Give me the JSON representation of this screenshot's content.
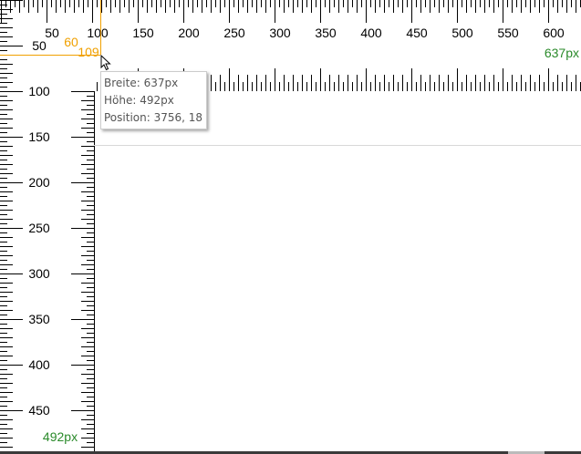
{
  "ruler": {
    "horizontal_labels": [
      "50",
      "100",
      "150",
      "200",
      "250",
      "300",
      "350",
      "400",
      "450",
      "500",
      "550",
      "600"
    ],
    "vertical_labels": [
      "50",
      "100",
      "150",
      "200",
      "250",
      "300",
      "350",
      "400",
      "450"
    ],
    "width_label": "637px",
    "height_label": "492px",
    "cursor_y_label": "60",
    "cursor_x_label": "109"
  },
  "tooltip": {
    "width": "Breite: 637px",
    "height": "Höhe: 492px",
    "position": "Position: 3756, 18"
  },
  "colors": {
    "crosshair": "#f0a000",
    "size_label": "#2a8a2a",
    "ticks": "#000000"
  }
}
